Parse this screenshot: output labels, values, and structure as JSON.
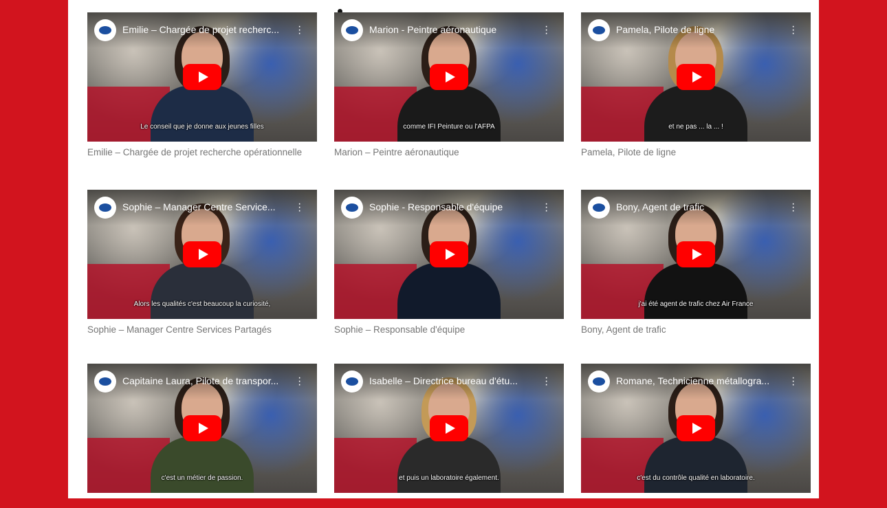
{
  "videos": [
    {
      "title": "Emilie – Chargée de projet recherc...",
      "subtitle": "Le conseil que je donne aux jeunes filles",
      "caption": "Emilie – Chargée de projet recherche opérationnelle"
    },
    {
      "title": "Marion - Peintre aéronautique",
      "subtitle": "comme IFI Peinture ou l'AFPA",
      "caption": "Marion – Peintre aéronautique"
    },
    {
      "title": "Pamela, Pilote de ligne",
      "subtitle": "et ne pas ... la ... !",
      "caption": "Pamela, Pilote de ligne"
    },
    {
      "title": "Sophie – Manager Centre Service...",
      "subtitle": "Alors les qualités c'est beaucoup la curiosité,",
      "caption": "Sophie – Manager Centre Services Partagés"
    },
    {
      "title": "Sophie - Responsable d'équipe",
      "subtitle": "",
      "caption": "Sophie – Responsable d'équipe"
    },
    {
      "title": "Bony, Agent de trafic",
      "subtitle": "j'ai été agent de trafic chez Air France",
      "caption": "Bony, Agent de trafic"
    },
    {
      "title": "Capitaine Laura, Pilote de transpor...",
      "subtitle": "c'est un métier de passion.",
      "caption": ""
    },
    {
      "title": "Isabelle – Directrice bureau d'étu...",
      "subtitle": "et puis un laboratoire également.",
      "caption": ""
    },
    {
      "title": "Romane, Technicienne métallogra...",
      "subtitle": "c'est du contrôle qualité en laboratoire.",
      "caption": ""
    }
  ],
  "colors": {
    "page_bg": "#d2141e",
    "play": "#ff0000",
    "caption": "#757575"
  },
  "icons": {
    "channel": "channel-logo-icon",
    "menu": "more-vert-icon",
    "play": "youtube-play-icon"
  }
}
